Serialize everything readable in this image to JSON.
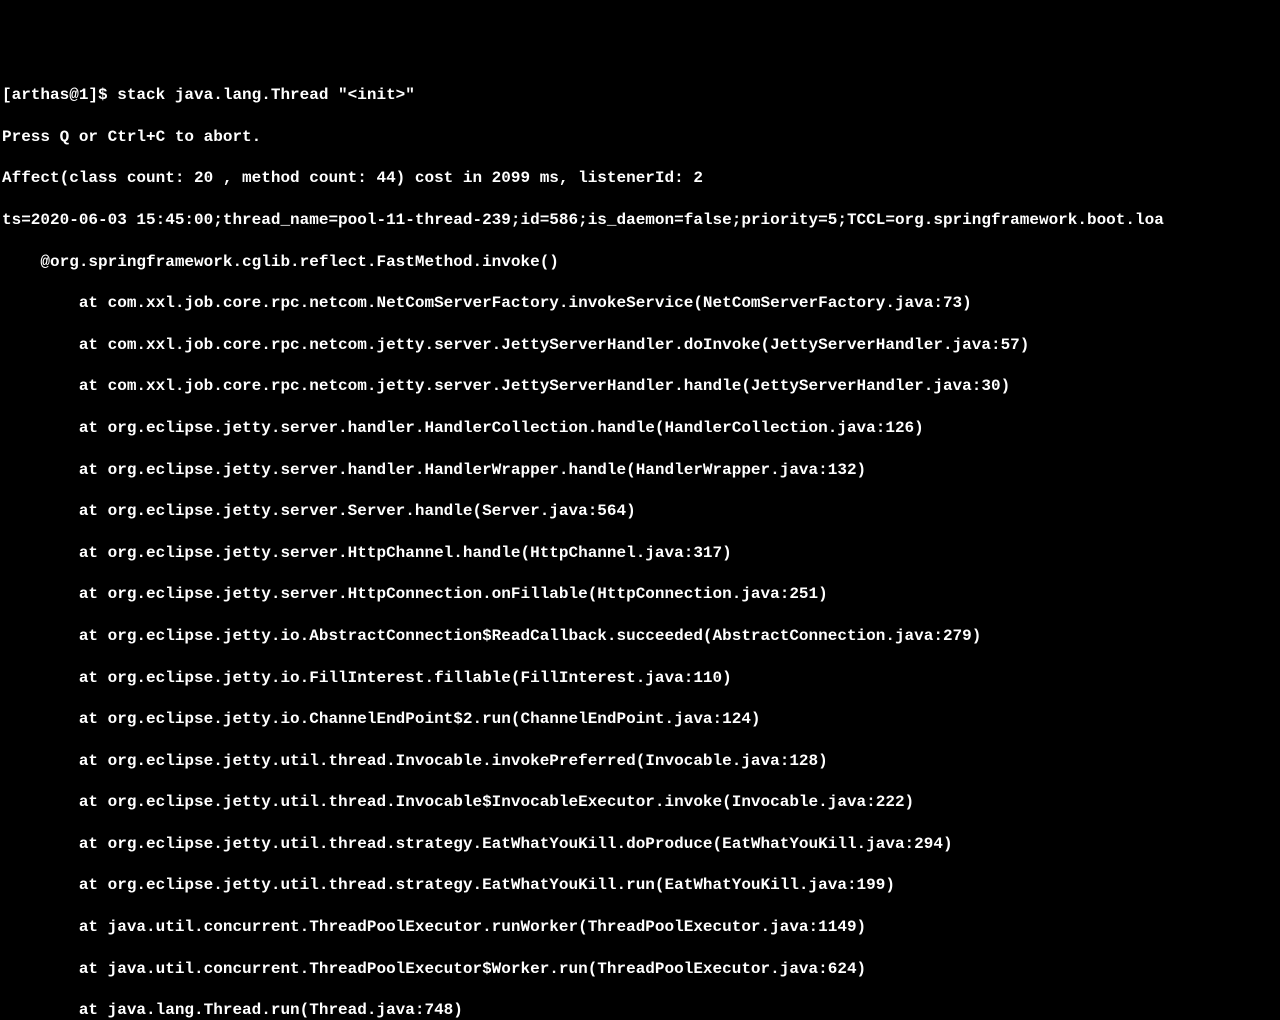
{
  "terminal": {
    "truncated_top": "...",
    "prompt": "[arthas@1]$ stack java.lang.Thread \"<init>\"",
    "abort_hint": "Press Q or Ctrl+C to abort.",
    "affect_line": "Affect(class count: 20 , method count: 44) cost in 2099 ms, listenerId: 2",
    "thread_info": "ts=2020-06-03 15:45:00;thread_name=pool-11-thread-239;id=586;is_daemon=false;priority=5;TCCL=org.springframework.boot.loa",
    "invoke_line": "    @org.springframework.cglib.reflect.FastMethod.invoke()",
    "stack": [
      "        at com.xxl.job.core.rpc.netcom.NetComServerFactory.invokeService(NetComServerFactory.java:73)",
      "        at com.xxl.job.core.rpc.netcom.jetty.server.JettyServerHandler.doInvoke(JettyServerHandler.java:57)",
      "        at com.xxl.job.core.rpc.netcom.jetty.server.JettyServerHandler.handle(JettyServerHandler.java:30)",
      "        at org.eclipse.jetty.server.handler.HandlerCollection.handle(HandlerCollection.java:126)",
      "        at org.eclipse.jetty.server.handler.HandlerWrapper.handle(HandlerWrapper.java:132)",
      "        at org.eclipse.jetty.server.Server.handle(Server.java:564)",
      "        at org.eclipse.jetty.server.HttpChannel.handle(HttpChannel.java:317)",
      "        at org.eclipse.jetty.server.HttpConnection.onFillable(HttpConnection.java:251)",
      "        at org.eclipse.jetty.io.AbstractConnection$ReadCallback.succeeded(AbstractConnection.java:279)",
      "        at org.eclipse.jetty.io.FillInterest.fillable(FillInterest.java:110)",
      "        at org.eclipse.jetty.io.ChannelEndPoint$2.run(ChannelEndPoint.java:124)",
      "        at org.eclipse.jetty.util.thread.Invocable.invokePreferred(Invocable.java:128)",
      "        at org.eclipse.jetty.util.thread.Invocable$InvocableExecutor.invoke(Invocable.java:222)",
      "        at org.eclipse.jetty.util.thread.strategy.EatWhatYouKill.doProduce(EatWhatYouKill.java:294)",
      "        at org.eclipse.jetty.util.thread.strategy.EatWhatYouKill.run(EatWhatYouKill.java:199)",
      "        at java.util.concurrent.ThreadPoolExecutor.runWorker(ThreadPoolExecutor.java:1149)",
      "        at java.util.concurrent.ThreadPoolExecutor$Worker.run(ThreadPoolExecutor.java:624)",
      "        at java.lang.Thread.run(Thread.java:748)"
    ]
  }
}
